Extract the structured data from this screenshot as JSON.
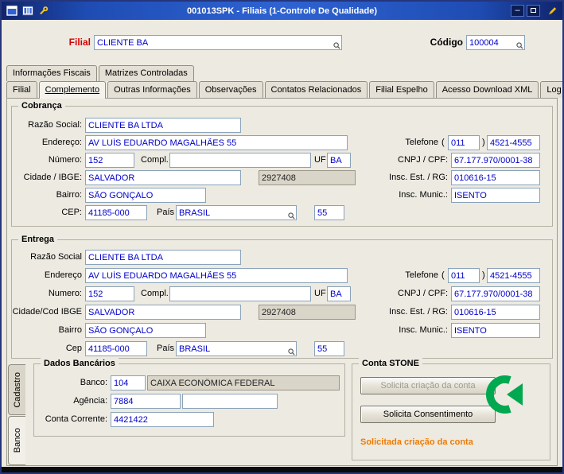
{
  "colors": {
    "title_bar_blue": "#2f63d2",
    "filial_label_red": "#d40000",
    "input_text_blue": "#0000cd",
    "status_orange": "#ee7b00",
    "stone_green": "#00a84f"
  },
  "window": {
    "title": "001013SPK - Filiais (1-Controle De Qualidade)",
    "minimize_glyph": "–",
    "icons": {
      "app": "window-icon",
      "columns": "columns-icon",
      "wrench": "wrench-icon",
      "maximize": "maximize-icon",
      "edit": "pencil-icon",
      "lookup": "magnifier-icon",
      "stone": "stone-logo-icon"
    }
  },
  "header": {
    "filial_label": "Filial",
    "filial_value": "CLIENTE BA",
    "codigo_label": "Código",
    "codigo_value": "100004"
  },
  "tabs_top": [
    {
      "label": "Informações Fiscais"
    },
    {
      "label": "Matrizes Controladas"
    }
  ],
  "tabs_main": [
    {
      "label": "Filial"
    },
    {
      "label": "Complemento",
      "active": true
    },
    {
      "label": "Outras Informações"
    },
    {
      "label": "Observações"
    },
    {
      "label": "Contatos Relacionados"
    },
    {
      "label": "Filial Espelho"
    },
    {
      "label": "Acesso Download XML"
    },
    {
      "label": "Log"
    }
  ],
  "cobranca": {
    "title": "Cobrança",
    "labels": {
      "razao": "Razão Social:",
      "endereco": "Endereço:",
      "numero": "Número:",
      "compl": "Compl.",
      "uf": "UF",
      "cidade": "Cidade / IBGE:",
      "bairro": "Bairro:",
      "cep": "CEP:",
      "pais": "País",
      "telefone": "Telefone",
      "tel_open": "(",
      "tel_close": ")",
      "cnpj": "CNPJ / CPF:",
      "insc_est": "Insc. Est. / RG:",
      "insc_mun": "Insc. Munic.:"
    },
    "values": {
      "razao": "CLIENTE BA LTDA",
      "endereco": "AV LUÍS EDUARDO MAGALHÃES 55",
      "numero": "152",
      "compl": "",
      "uf": "BA",
      "cidade": "SALVADOR",
      "ibge": "2927408",
      "bairro": "SÃO GONÇALO",
      "cep": "41185-000",
      "pais": "BRASIL",
      "pais_cod": "55",
      "ddd": "011",
      "fone": "4521-4555",
      "cnpj": "67.177.970/0001-38",
      "insc_est": "010616-15",
      "insc_mun": "ISENTO"
    }
  },
  "entrega": {
    "title": "Entrega",
    "labels": {
      "razao": "Razão Social",
      "endereco": "Endereço",
      "numero": "Numero:",
      "compl": "Compl.",
      "uf": "UF",
      "cidade": "Cidade/Cod IBGE",
      "bairro": "Bairro",
      "cep": "Cep",
      "pais": "País",
      "telefone": "Telefone",
      "tel_open": "(",
      "tel_close": ")",
      "cnpj": "CNPJ / CPF:",
      "insc_est": "Insc. Est. / RG:",
      "insc_mun": "Insc. Munic.:"
    },
    "values": {
      "razao": "CLIENTE BA LTDA",
      "endereco": "AV LUÍS EDUARDO MAGALHÃES 55",
      "numero": "152",
      "compl": "",
      "uf": "BA",
      "cidade": "SALVADOR",
      "ibge": "2927408",
      "bairro": "SÃO GONÇALO",
      "cep": "41185-000",
      "pais": "BRASIL",
      "pais_cod": "55",
      "ddd": "011",
      "fone": "4521-4555",
      "cnpj": "67.177.970/0001-38",
      "insc_est": "010616-15",
      "insc_mun": "ISENTO"
    }
  },
  "side_tabs": [
    {
      "label": "Cadastro"
    },
    {
      "label": "Banco",
      "active": true
    }
  ],
  "dados_bancarios": {
    "title": "Dados Bancários",
    "banco_label": "Banco:",
    "banco_codigo": "104",
    "banco_nome": "CAIXA ECONÔMICA FEDERAL",
    "agencia_label": "Agência:",
    "agencia": "7884",
    "agencia_extra": "",
    "conta_label": "Conta Corrente:",
    "conta": "4421422"
  },
  "conta_stone": {
    "title": "Conta STONE",
    "botao_criacao": "Solicita criação da conta",
    "botao_consentimento": "Solicita Consentimento",
    "status": "Solicitada criação da conta"
  }
}
